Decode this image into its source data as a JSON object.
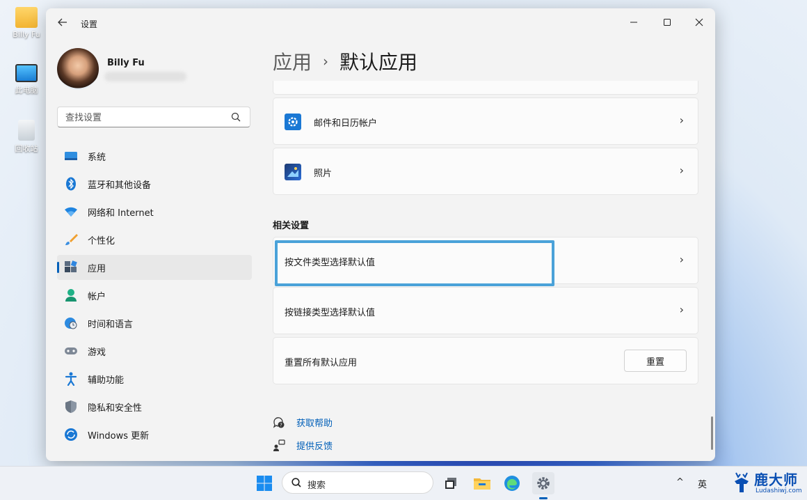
{
  "desktop": {
    "icons": [
      {
        "label": "Billy Fu",
        "icon": "folder-icon"
      },
      {
        "label": "此电脑",
        "icon": "computer-icon"
      },
      {
        "label": "回收站",
        "icon": "recycle-bin-icon"
      }
    ]
  },
  "window": {
    "title": "设置",
    "controls": {
      "minimize": "—",
      "maximize": "☐",
      "close": "✕"
    }
  },
  "profile": {
    "name": "Billy Fu"
  },
  "search": {
    "placeholder": "查找设置"
  },
  "nav": {
    "items": [
      {
        "label": "系统",
        "icon": "display-icon"
      },
      {
        "label": "蓝牙和其他设备",
        "icon": "bluetooth-icon"
      },
      {
        "label": "网络和 Internet",
        "icon": "wifi-icon"
      },
      {
        "label": "个性化",
        "icon": "brush-icon"
      },
      {
        "label": "应用",
        "icon": "apps-icon",
        "active": true
      },
      {
        "label": "帐户",
        "icon": "person-icon"
      },
      {
        "label": "时间和语言",
        "icon": "globe-clock-icon"
      },
      {
        "label": "游戏",
        "icon": "gamepad-icon"
      },
      {
        "label": "辅助功能",
        "icon": "accessibility-icon"
      },
      {
        "label": "隐私和安全性",
        "icon": "shield-icon"
      },
      {
        "label": "Windows 更新",
        "icon": "update-icon"
      }
    ]
  },
  "breadcrumb": {
    "parent": "应用",
    "separator": "›",
    "current": "默认应用"
  },
  "apps_list": [
    {
      "label": "邮件和日历帐户",
      "icon": "gear-icon"
    },
    {
      "label": "照片",
      "icon": "photos-icon"
    }
  ],
  "related": {
    "title": "相关设置",
    "items": [
      {
        "label": "按文件类型选择默认值"
      },
      {
        "label": "按链接类型选择默认值"
      }
    ],
    "reset": {
      "label": "重置所有默认应用",
      "button": "重置"
    }
  },
  "links": {
    "help": "获取帮助",
    "feedback": "提供反馈"
  },
  "taskbar": {
    "search_label": "搜索",
    "tray_caret": "^",
    "ime": "英"
  },
  "watermark": {
    "title": "鹿大师",
    "subtitle": "Ludashiwj.com"
  },
  "colors": {
    "accent": "#005fb8",
    "highlight_border": "#4aa2d9"
  }
}
